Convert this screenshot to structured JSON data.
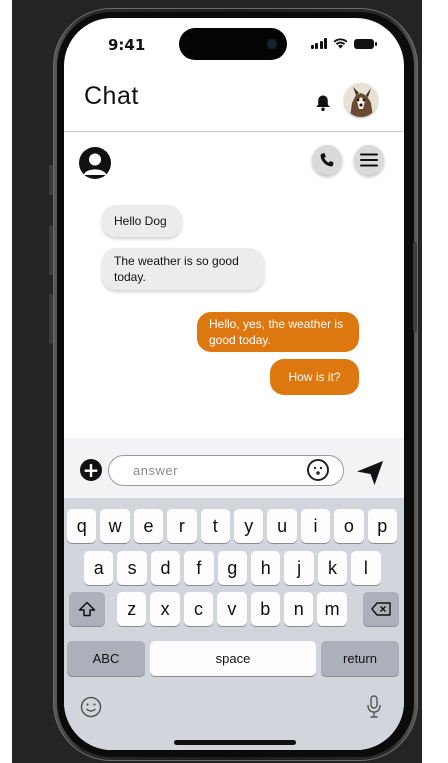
{
  "status": {
    "time": "9:41"
  },
  "header": {
    "title": "Chat"
  },
  "messages": [
    {
      "text": "Hello Dog",
      "side": "incoming"
    },
    {
      "text": "The weather is so good today.",
      "side": "incoming"
    },
    {
      "text": "Hello, yes, the weather is good today.",
      "side": "outgoing"
    },
    {
      "text": "How is it?",
      "side": "outgoing"
    }
  ],
  "composer": {
    "placeholder": "answer"
  },
  "keyboard": {
    "row1": [
      "q",
      "w",
      "e",
      "r",
      "t",
      "y",
      "u",
      "i",
      "o",
      "p"
    ],
    "row2": [
      "a",
      "s",
      "d",
      "f",
      "g",
      "h",
      "j",
      "k",
      "l"
    ],
    "row3": [
      "z",
      "x",
      "c",
      "v",
      "b",
      "n",
      "m"
    ],
    "abc_label": "ABC",
    "space_label": "space",
    "return_label": "return"
  },
  "colors": {
    "accent": "#dd7710",
    "incoming_bubble": "#ececec",
    "keyboard_bg": "#d2d5db"
  },
  "icons": [
    "bell-icon",
    "phone-icon",
    "menu-icon",
    "plus-icon",
    "emoji-icon",
    "send-icon",
    "shift-icon",
    "backspace-icon",
    "emoji-keyboard-icon",
    "microphone-icon"
  ]
}
